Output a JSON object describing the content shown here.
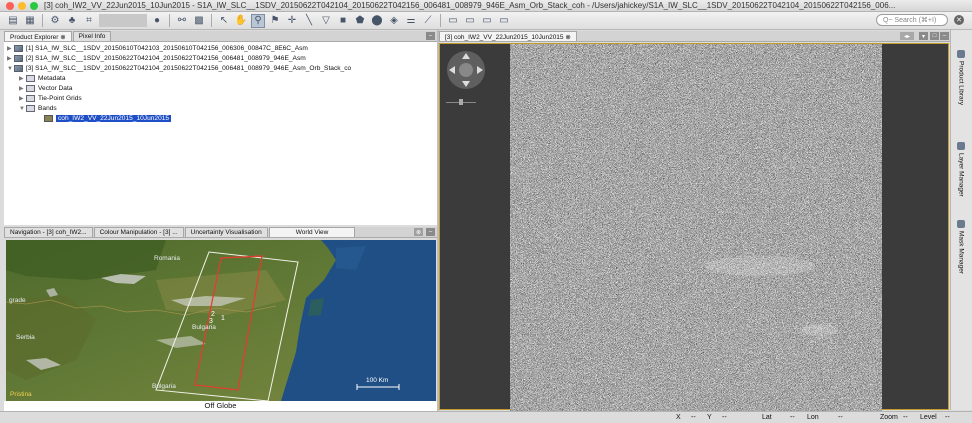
{
  "window": {
    "title": "[3] coh_IW2_VV_22Jun2015_10Jun2015 - S1A_IW_SLC__1SDV_20150622T042104_20150622T042156_006481_008979_946E_Asm_Orb_Stack_coh - /Users/jahickey/S1A_IW_SLC__1SDV_20150622T042104_20150622T042156_006..."
  },
  "toolbar": {
    "search_placeholder": "Q~ Search (⌘+I)"
  },
  "left_tabs": [
    {
      "label": "Product Explorer ⊗"
    },
    {
      "label": "Pixel Info"
    }
  ],
  "products": [
    {
      "label": "[1] S1A_IW_SLC__1SDV_20150610T042103_20150610T042156_006306_00847C_8E6C_Asm"
    },
    {
      "label": "[2] S1A_IW_SLC__1SDV_20150622T042104_20150622T042156_006481_008979_946E_Asm"
    },
    {
      "label": "[3] S1A_IW_SLC__1SDV_20150622T042104_20150622T042156_006481_008979_946E_Asm_Orb_Stack_co"
    }
  ],
  "tree_nodes": [
    {
      "label": "Metadata"
    },
    {
      "label": "Vector Data"
    },
    {
      "label": "Tie-Point Grids"
    },
    {
      "label": "Bands"
    }
  ],
  "band": {
    "label": "coh_IW2_VV_22Jun2015_10Jun2015"
  },
  "bottom_tabs": [
    {
      "label": "Navigation - [3] coh_IW2..."
    },
    {
      "label": "Colour Manipulation - [3] ..."
    },
    {
      "label": "Uncertainty Visualisation"
    },
    {
      "label": "World View"
    }
  ],
  "map": {
    "places": [
      {
        "label": "Romania"
      },
      {
        "label": "grade"
      },
      {
        "label": "Serbia"
      },
      {
        "label": "Bulgaria"
      },
      {
        "label": "Pristina"
      }
    ],
    "footprint_labels": [
      "2",
      "1",
      "3"
    ],
    "scale": "100 Km",
    "globe_caption": "Off Globe"
  },
  "image_tab": {
    "label": "[3] coh_IW2_VV_22Jun2015_10Jun2015 ⊗"
  },
  "right_tabs": [
    {
      "label": "Product Library"
    },
    {
      "label": "Layer Manager"
    },
    {
      "label": "Mask Manager"
    }
  ],
  "status": {
    "x": "X",
    "x_val": "--",
    "y": "Y",
    "y_val": "--",
    "lat": "Lat",
    "lat_val": "--",
    "lon": "Lon",
    "lon_val": "--",
    "zoom": "Zoom",
    "zoom_val": "--",
    "level": "Level",
    "level_val": "--"
  },
  "colors": {
    "selection": "#1f4fc7",
    "image_frame": "#c49a2a",
    "footprint_outer": "#f2f2e8",
    "footprint_inner": "#e63b2e"
  }
}
